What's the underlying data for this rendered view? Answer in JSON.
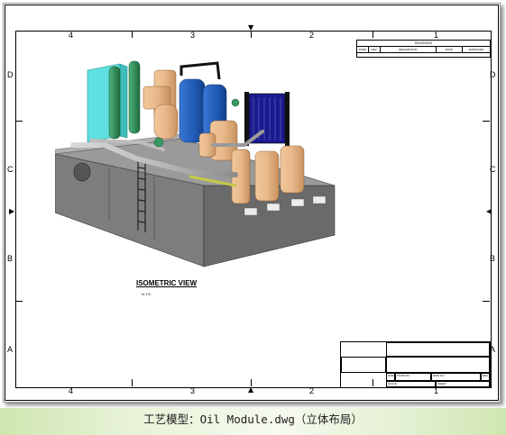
{
  "drawing": {
    "top_zones": [
      "4",
      "3",
      "2",
      "1"
    ],
    "bottom_zones": [
      "4",
      "3",
      "2",
      "1"
    ],
    "left_zones": [
      "D",
      "C",
      "B",
      "A"
    ],
    "right_zones": [
      "D",
      "C",
      "B",
      "A"
    ],
    "view_title": "ISOMETRIC VIEW",
    "view_scale": "N.T.S."
  },
  "revisions": {
    "title": "REVISIONS",
    "columns": [
      "ZONE",
      "REV",
      "DESCRIPTION",
      "DATE",
      "APPROVED"
    ]
  },
  "title_block": {
    "size_label": "SIZE",
    "fscm_label": "FSCM NO",
    "dwg_label": "DWG NO",
    "rev_label": "REV",
    "scale_label": "SCALE",
    "sheet_label": "SHEET"
  },
  "caption": "工艺模型：Oil Module.dwg（立体布局）",
  "colors": {
    "skid": "#7d7d7d",
    "skid_dark": "#5b5b5b",
    "tank_tan": "#e8b88a",
    "vessel_blue": "#1f5bb5",
    "cyan_panel": "#5fe0e0",
    "green_pipe": "#2e8b57",
    "plate_hx": "#1a1a8c"
  }
}
